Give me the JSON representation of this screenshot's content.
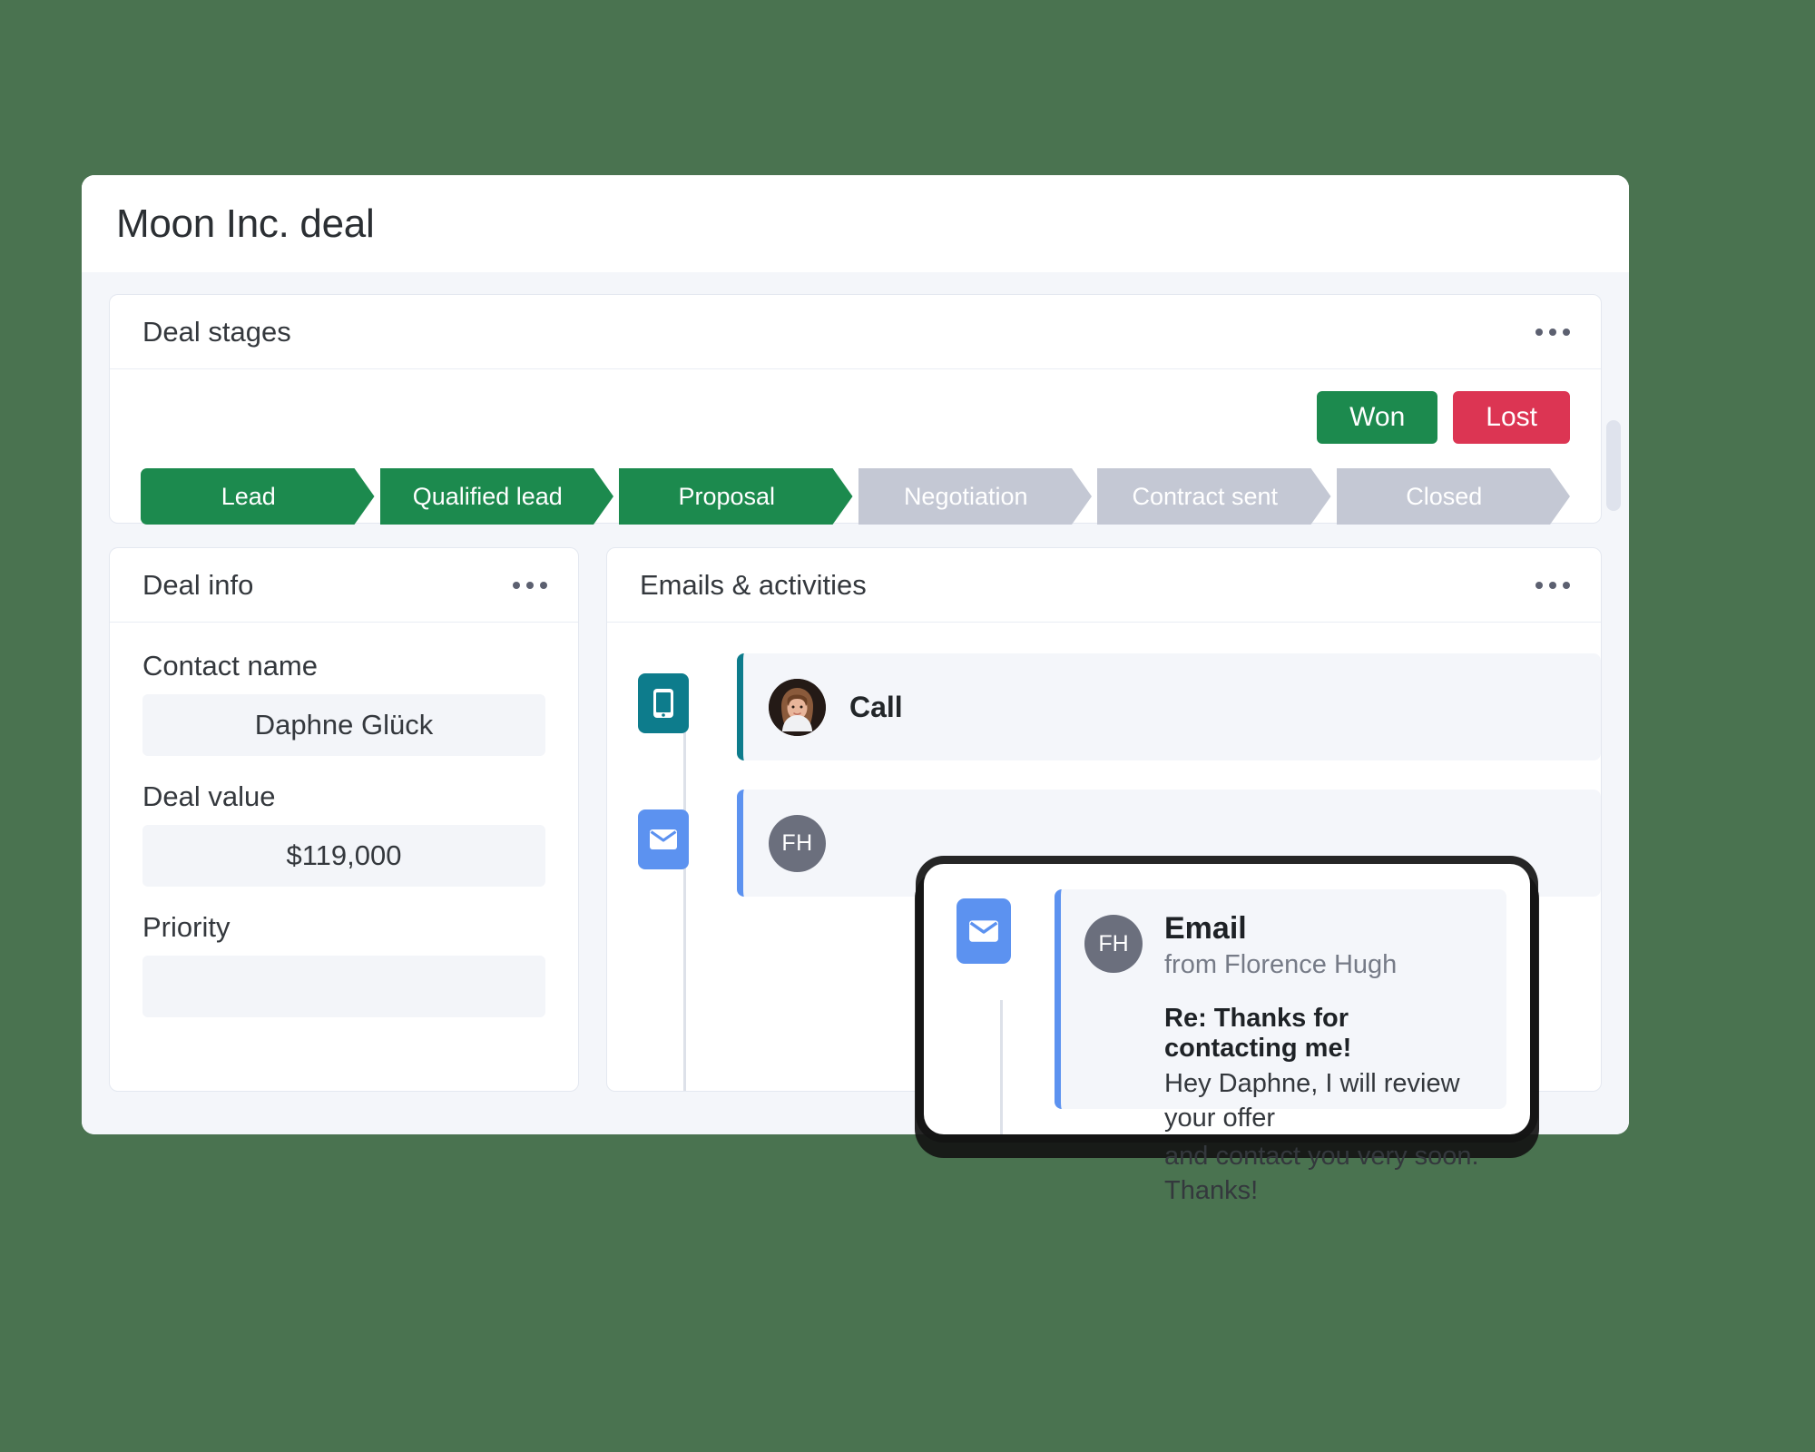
{
  "window": {
    "title": "Moon Inc. deal"
  },
  "deal_stages": {
    "title": "Deal stages",
    "menu_icon": "more-horizontal-icon",
    "won_label": "Won",
    "lost_label": "Lost",
    "won_color": "#1c8a4e",
    "lost_color": "#dc3553",
    "active_stage_color": "#1c8a4e",
    "inactive_stage_color": "#c4c8d4",
    "stages": [
      {
        "label": "Lead",
        "state": "done"
      },
      {
        "label": "Qualified lead",
        "state": "done"
      },
      {
        "label": "Proposal",
        "state": "done"
      },
      {
        "label": "Negotiation",
        "state": "todo"
      },
      {
        "label": "Contract sent",
        "state": "todo"
      },
      {
        "label": "Closed",
        "state": "todo"
      }
    ]
  },
  "deal_info": {
    "title": "Deal info",
    "menu_icon": "more-horizontal-icon",
    "fields": [
      {
        "label": "Contact name",
        "value": "Daphne Glück"
      },
      {
        "label": "Deal value",
        "value": "$119,000"
      },
      {
        "label": "Priority",
        "value": ""
      }
    ]
  },
  "activities": {
    "title": "Emails & activities",
    "menu_icon": "more-horizontal-icon",
    "items": [
      {
        "type": "Call",
        "icon": "phone-icon",
        "icon_color": "#0d7c8c",
        "avatar_initials": "",
        "avatar_type": "photo"
      },
      {
        "type": "",
        "icon": "envelope-icon",
        "icon_color": "#5c92f0",
        "avatar_initials": "FH",
        "avatar_type": "initials"
      }
    ]
  },
  "float_email": {
    "icon": "envelope-icon",
    "icon_color": "#5c92f0",
    "avatar_initials": "FH",
    "kind": "Email",
    "from": "from Florence Hugh",
    "subject": "Re: Thanks for contacting me!",
    "message_line1": "Hey Daphne, I will review your offer",
    "message_line2": "and contact you very soon. Thanks!"
  },
  "scrollbar": {
    "name": "vertical-scrollbar"
  },
  "background_color": "#4a7350"
}
